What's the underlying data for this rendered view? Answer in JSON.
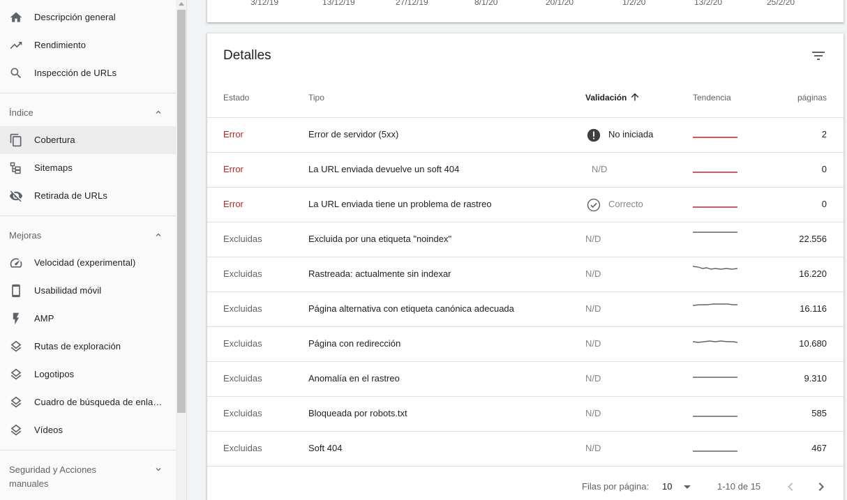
{
  "sidebar": {
    "top_items": [
      {
        "label": "Descripción general",
        "icon": "home-icon"
      },
      {
        "label": "Rendimiento",
        "icon": "trending-up-icon"
      },
      {
        "label": "Inspección de URLs",
        "icon": "search-icon"
      }
    ],
    "sections": [
      {
        "title": "Índice",
        "expanded": true,
        "items": [
          {
            "label": "Cobertura",
            "icon": "copy-icon",
            "active": true
          },
          {
            "label": "Sitemaps",
            "icon": "sitemap-icon"
          },
          {
            "label": "Retirada de URLs",
            "icon": "eye-off-icon"
          }
        ]
      },
      {
        "title": "Mejoras",
        "expanded": true,
        "items": [
          {
            "label": "Velocidad (experimental)",
            "icon": "speedometer-icon"
          },
          {
            "label": "Usabilidad móvil",
            "icon": "smartphone-icon"
          },
          {
            "label": "AMP",
            "icon": "bolt-icon"
          },
          {
            "label": "Rutas de exploración",
            "icon": "layers-icon"
          },
          {
            "label": "Logotipos",
            "icon": "layers-icon"
          },
          {
            "label": "Cuadro de búsqueda de enla…",
            "icon": "layers-icon"
          },
          {
            "label": "Vídeos",
            "icon": "layers-icon"
          }
        ]
      },
      {
        "title_line1": "Seguridad y Acciones",
        "title_line2": "manuales",
        "expanded": false
      }
    ]
  },
  "chart_axis": {
    "dates": [
      "3/12/19",
      "13/12/19",
      "27/12/19",
      "8/1/20",
      "20/1/20",
      "1/2/20",
      "13/2/20",
      "25/2/20"
    ]
  },
  "details": {
    "title": "Detalles",
    "columns": {
      "estado": "Estado",
      "tipo": "Tipo",
      "validacion": "Validación",
      "tendencia": "Tendencia",
      "paginas": "páginas"
    },
    "rows": [
      {
        "estado": "Error",
        "tipo": "Error de servidor (5xx)",
        "validacion": "No iniciada",
        "validation_icon": "alert-circle-icon",
        "paginas": "2",
        "trend_color": "#c5221f"
      },
      {
        "estado": "Error",
        "tipo": "La URL enviada devuelve un soft 404",
        "validacion": "N/D",
        "validation_icon": "",
        "paginas": "0",
        "trend_color": "#c5221f"
      },
      {
        "estado": "Error",
        "tipo": "La URL enviada tiene un problema de rastreo",
        "validacion": "Correcto",
        "validation_icon": "check-circle-icon",
        "paginas": "0",
        "trend_color": "#c5221f"
      },
      {
        "estado": "Excluidas",
        "tipo": "Excluida por una etiqueta \"noindex\"",
        "validacion": "N/D",
        "validation_icon": "",
        "paginas": "22.556",
        "trend_color": "#5f6368"
      },
      {
        "estado": "Excluidas",
        "tipo": "Rastreada: actualmente sin indexar",
        "validacion": "N/D",
        "validation_icon": "",
        "paginas": "16.220",
        "trend_color": "#5f6368"
      },
      {
        "estado": "Excluidas",
        "tipo": "Página alternativa con etiqueta canónica adecuada",
        "validacion": "N/D",
        "validation_icon": "",
        "paginas": "16.116",
        "trend_color": "#5f6368"
      },
      {
        "estado": "Excluidas",
        "tipo": "Página con redirección",
        "validacion": "N/D",
        "validation_icon": "",
        "paginas": "10.680",
        "trend_color": "#5f6368"
      },
      {
        "estado": "Excluidas",
        "tipo": "Anomalía en el rastreo",
        "validacion": "N/D",
        "validation_icon": "",
        "paginas": "9.310",
        "trend_color": "#5f6368"
      },
      {
        "estado": "Excluidas",
        "tipo": "Bloqueada por robots.txt",
        "validacion": "N/D",
        "validation_icon": "",
        "paginas": "585",
        "trend_color": "#5f6368"
      },
      {
        "estado": "Excluidas",
        "tipo": "Soft 404",
        "validacion": "N/D",
        "validation_icon": "",
        "paginas": "467",
        "trend_color": "#5f6368"
      }
    ],
    "pagination": {
      "rows_per_page_label": "Filas por página:",
      "rows_per_page_value": "10",
      "range": "1-10 de 15"
    }
  },
  "colors": {
    "error": "#c5221f",
    "active_nav": "#ececec"
  }
}
